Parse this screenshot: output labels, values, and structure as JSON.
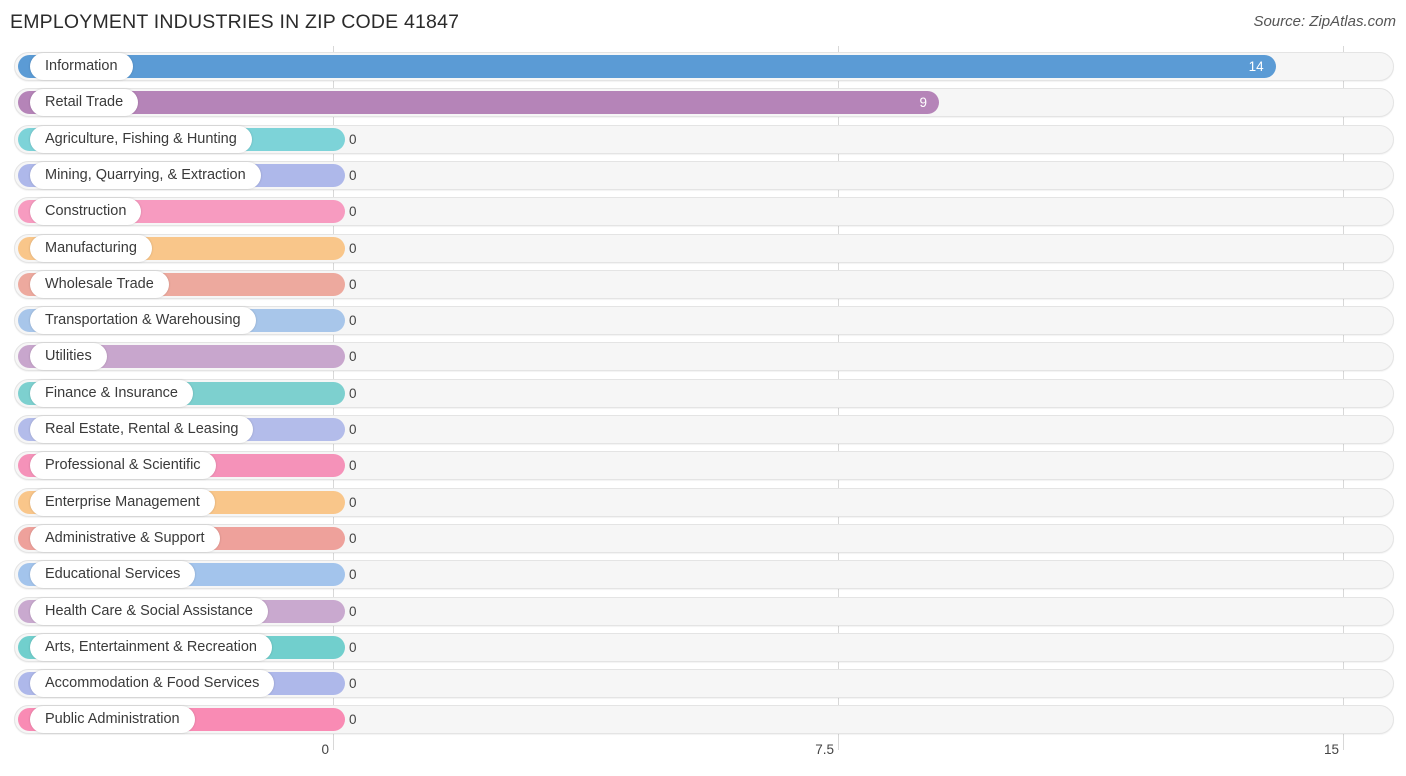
{
  "header": {
    "title": "EMPLOYMENT INDUSTRIES IN ZIP CODE 41847",
    "source": "Source: ZipAtlas.com"
  },
  "chart_data": {
    "type": "bar",
    "orientation": "horizontal",
    "title": "EMPLOYMENT INDUSTRIES IN ZIP CODE 41847",
    "xlabel": "",
    "ylabel": "",
    "xlim": [
      0,
      15
    ],
    "xticks": [
      "0",
      "7.5",
      "15"
    ],
    "xtick_values": [
      0,
      7.5,
      15
    ],
    "grid": true,
    "legend": "none",
    "categories": [
      "Information",
      "Retail Trade",
      "Agriculture, Fishing & Hunting",
      "Mining, Quarrying, & Extraction",
      "Construction",
      "Manufacturing",
      "Wholesale Trade",
      "Transportation & Warehousing",
      "Utilities",
      "Finance & Insurance",
      "Real Estate, Rental & Leasing",
      "Professional & Scientific",
      "Enterprise Management",
      "Administrative & Support",
      "Educational Services",
      "Health Care & Social Assistance",
      "Arts, Entertainment & Recreation",
      "Accommodation & Food Services",
      "Public Administration"
    ],
    "values": [
      14,
      9,
      0,
      0,
      0,
      0,
      0,
      0,
      0,
      0,
      0,
      0,
      0,
      0,
      0,
      0,
      0,
      0,
      0
    ],
    "value_labels": [
      "14",
      "9",
      "0",
      "0",
      "0",
      "0",
      "0",
      "0",
      "0",
      "0",
      "0",
      "0",
      "0",
      "0",
      "0",
      "0",
      "0",
      "0",
      "0"
    ],
    "colors": [
      "#5b9bd5",
      "#b584b8",
      "#7dd3d8",
      "#aeb8ea",
      "#f79bc0",
      "#f9c68a",
      "#eda99e",
      "#a8c6ea",
      "#c8a6cd",
      "#7dd0cf",
      "#b3bcea",
      "#f592b9",
      "#f9c68a",
      "#eea19b",
      "#a3c4ec",
      "#c9a9cf",
      "#71cfcd",
      "#aeb8ea",
      "#f98bb4"
    ]
  }
}
